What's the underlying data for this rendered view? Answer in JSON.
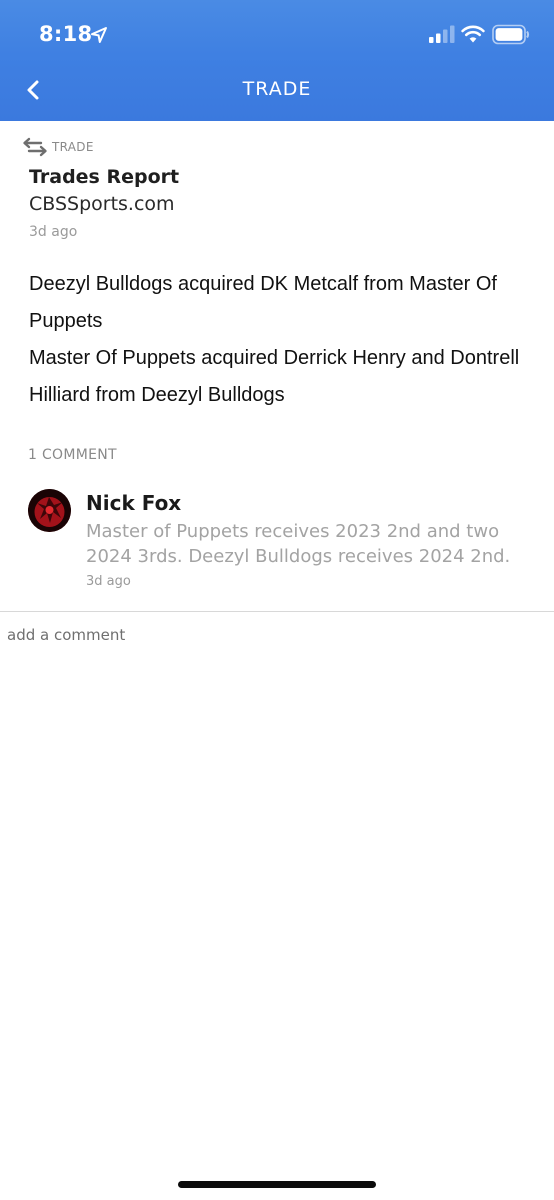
{
  "status_bar": {
    "time": "8:18",
    "icons": [
      "location-arrow-icon",
      "cellular-signal-icon",
      "wifi-icon",
      "battery-icon"
    ]
  },
  "nav": {
    "title": "TRADE",
    "back_icon": "chevron-left-icon",
    "color": "#3f80e2"
  },
  "post": {
    "tag_label": "TRADE",
    "tag_icon": "swap-arrows-icon",
    "title": "Trades Report",
    "source": "CBSSports.com",
    "age": "3d ago",
    "body_lines": [
      "Deezyl Bulldogs acquired DK Metcalf from Master Of Puppets",
      "Master Of Puppets acquired Derrick Henry and Dontrell Hilliard from Deezyl Bulldogs"
    ]
  },
  "comments": {
    "count_label": "1 COMMENT",
    "items": [
      {
        "author": "Nick Fox",
        "text": "Master of Puppets receives 2023 2nd and two 2024 3rds. Deezyl Bulldogs receives 2024 2nd.",
        "age": "3d ago",
        "avatar": "avatar"
      }
    ],
    "input_placeholder": "add a comment"
  }
}
